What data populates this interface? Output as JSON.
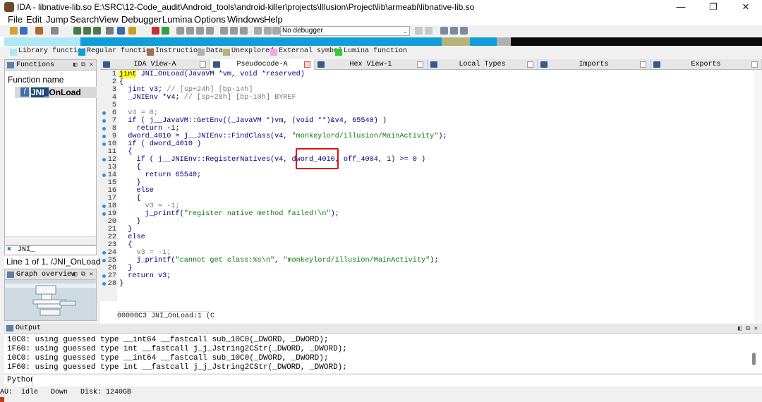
{
  "window": {
    "title": "IDA - libnative-lib.so E:\\SRC\\12-Code_audit\\Android_tools\\android-killer\\projects\\Illusion\\Project\\lib\\armeabi\\libnative-lib.so",
    "minimize": "—",
    "maximize": "❐",
    "close": "✕"
  },
  "menu": [
    "File",
    "Edit",
    "Jump",
    "Search",
    "View",
    "Debugger",
    "Lumina",
    "Options",
    "Windows",
    "Help"
  ],
  "toolbar": {
    "debugger": "No debugger"
  },
  "legend": [
    {
      "label": "Library function",
      "color": "#aee8f5"
    },
    {
      "label": "Regular function",
      "color": "#0f9ed8"
    },
    {
      "label": "Instruction",
      "color": "#a06f56"
    },
    {
      "label": "Data",
      "color": "#b0b0b0"
    },
    {
      "label": "Unexplored",
      "color": "#b7b377"
    },
    {
      "label": "External symbol",
      "color": "#f5a8e0"
    },
    {
      "label": "Lumina function",
      "color": "#33cc33"
    }
  ],
  "tabs": [
    "IDA View-A",
    "Pseudocode-A",
    "Hex View-1",
    "Local Types",
    "Imports",
    "Exports"
  ],
  "functions_pane": {
    "title": "Functions",
    "buttons": "◧ ⧉ ✕",
    "column": "Function name",
    "icon_letter": "f",
    "selected_highlight": "JNI_",
    "selected_rest": "OnLoad",
    "filter": "JNI_",
    "filter_icon": "✖",
    "status": "Line 1 of 1, /JNI_OnLoad"
  },
  "graph_pane": {
    "title": "Graph overview"
  },
  "code": {
    "highlighted_box": "off_4004",
    "status": "00000C3 JNI_OnLoad:1 (C",
    "line_numbers": [
      "1",
      "2",
      "3",
      "4",
      "5",
      "6",
      "7",
      "8",
      "9",
      "10",
      "11",
      "12",
      "13",
      "14",
      "15",
      "16",
      "17",
      "18",
      "19",
      "20",
      "21",
      "22",
      "23",
      "24",
      "25",
      "26",
      "27",
      "28"
    ],
    "breakpoint_lines": [
      6,
      7,
      8,
      9,
      10,
      12,
      14,
      18,
      19,
      24,
      25,
      27,
      28
    ],
    "lines": [
      [
        {
          "c": "kw hlkw",
          "t": "jint"
        },
        {
          "c": "kw",
          "t": " JNI_OnLoad(JavaVM *vm, void *reserved)"
        }
      ],
      [
        {
          "c": "kw",
          "t": "{"
        }
      ],
      [
        {
          "c": "kw",
          "t": "  jint v3; "
        },
        {
          "c": "cm",
          "t": "// [sp+24h] [bp-14h]"
        }
      ],
      [
        {
          "c": "kw",
          "t": "  _JNIEnv *v4; "
        },
        {
          "c": "cm",
          "t": "// [sp+28h] [bp-10h] BYREF"
        }
      ],
      [
        {
          "c": "kw",
          "t": ""
        }
      ],
      [
        {
          "c": "gr",
          "t": "  v4 = 0;"
        }
      ],
      [
        {
          "c": "kw",
          "t": "  if ( j__JavaVM::GetEnv((_JavaVM *)vm, (void **)&v4, 65540) )"
        }
      ],
      [
        {
          "c": "kw",
          "t": "    return -1;"
        }
      ],
      [
        {
          "c": "kw",
          "t": "  dword_4010 = j__JNIEnv::FindClass(v4, "
        },
        {
          "c": "st",
          "t": "\"monkeylord/illusion/MainActivity\""
        },
        {
          "c": "kw",
          "t": ");"
        }
      ],
      [
        {
          "c": "kw",
          "t": "  if ( dword_4010 )"
        }
      ],
      [
        {
          "c": "kw",
          "t": "  {"
        }
      ],
      [
        {
          "c": "kw",
          "t": "    if ( j__JNIEnv::RegisterNatives(v4, dword_4010, off_4004, 1) >= 0 )"
        }
      ],
      [
        {
          "c": "kw",
          "t": "    {"
        }
      ],
      [
        {
          "c": "kw",
          "t": "      return 65540;"
        }
      ],
      [
        {
          "c": "kw",
          "t": "    }"
        }
      ],
      [
        {
          "c": "kw",
          "t": "    else"
        }
      ],
      [
        {
          "c": "kw",
          "t": "    {"
        }
      ],
      [
        {
          "c": "gr",
          "t": "      v3 = -1;"
        }
      ],
      [
        {
          "c": "kw",
          "t": "      j_printf("
        },
        {
          "c": "st",
          "t": "\"register native method failed!\\n\""
        },
        {
          "c": "kw",
          "t": ");"
        }
      ],
      [
        {
          "c": "kw",
          "t": "    }"
        }
      ],
      [
        {
          "c": "kw",
          "t": "  }"
        }
      ],
      [
        {
          "c": "kw",
          "t": "  else"
        }
      ],
      [
        {
          "c": "kw",
          "t": "  {"
        }
      ],
      [
        {
          "c": "gr",
          "t": "    v3 = -1;"
        }
      ],
      [
        {
          "c": "kw",
          "t": "    j_printf("
        },
        {
          "c": "st",
          "t": "\"cannot get class:%s\\n\""
        },
        {
          "c": "kw",
          "t": ", "
        },
        {
          "c": "st",
          "t": "\"monkeylord/illusion/MainActivity\""
        },
        {
          "c": "kw",
          "t": ");"
        }
      ],
      [
        {
          "c": "kw",
          "t": "  }"
        }
      ],
      [
        {
          "c": "kw",
          "t": "  return v3;"
        }
      ],
      [
        {
          "c": "kw",
          "t": "}"
        }
      ]
    ]
  },
  "output": {
    "title": "Output",
    "buttons": "◧ ⧉ ✕",
    "lines": [
      "10C0: using guessed type __int64 __fastcall sub_10C0(_DWORD, _DWORD);",
      "1F60: using guessed type int __fastcall j_j_Jstring2CStr(_DWORD, _DWORD);",
      "10C0: using guessed type __int64 __fastcall sub_10C0(_DWORD, _DWORD);",
      "1F60: using guessed type int __fastcall j_j_Jstring2CStr(_DWORD, _DWORD);"
    ]
  },
  "python": {
    "label": "Python"
  },
  "statusbar": {
    "text": "AU:  idle   Down   Disk: 1240GB"
  }
}
